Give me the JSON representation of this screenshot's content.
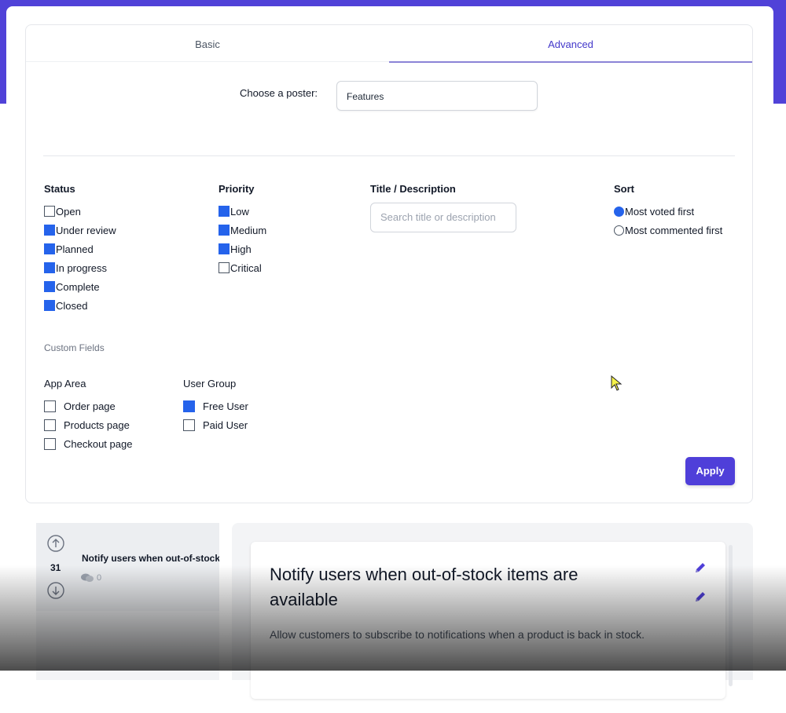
{
  "tabs": [
    {
      "label": "Basic",
      "active": false
    },
    {
      "label": "Advanced",
      "active": true
    }
  ],
  "poster": {
    "label": "Choose a poster:",
    "value": "Features"
  },
  "status": {
    "heading": "Status",
    "options": [
      {
        "label": "Open",
        "checked": false
      },
      {
        "label": "Under review",
        "checked": true
      },
      {
        "label": "Planned",
        "checked": true
      },
      {
        "label": "In progress",
        "checked": true
      },
      {
        "label": "Complete",
        "checked": true
      },
      {
        "label": "Closed",
        "checked": true
      }
    ]
  },
  "priority": {
    "heading": "Priority",
    "options": [
      {
        "label": "Low",
        "checked": true
      },
      {
        "label": "Medium",
        "checked": true
      },
      {
        "label": "High",
        "checked": true
      },
      {
        "label": "Critical",
        "checked": false
      }
    ]
  },
  "title_search": {
    "heading": "Title / Description",
    "placeholder": "Search title or description"
  },
  "sort": {
    "heading": "Sort",
    "options": [
      {
        "label": "Most voted first",
        "selected": true
      },
      {
        "label": "Most commented first",
        "selected": false
      }
    ]
  },
  "custom_fields": {
    "label": "Custom Fields",
    "app_area": {
      "heading": "App Area",
      "options": [
        {
          "label": "Order page",
          "checked": false
        },
        {
          "label": "Products page",
          "checked": false
        },
        {
          "label": "Checkout page",
          "checked": false
        }
      ]
    },
    "user_group": {
      "heading": "User Group",
      "options": [
        {
          "label": "Free User",
          "checked": true
        },
        {
          "label": "Paid User",
          "checked": false
        }
      ]
    }
  },
  "apply_label": "Apply",
  "post_list": [
    {
      "votes": "31",
      "title": "Notify users when out-of-stock items are available",
      "comments": "0"
    }
  ],
  "detail": {
    "title": "Notify users when out-of-stock items are available",
    "description": "Allow customers to subscribe to notifications when a product is back in stock."
  },
  "colors": {
    "accent": "#4f3fd9",
    "checkbox": "#2563eb",
    "band": "#5042d8"
  }
}
